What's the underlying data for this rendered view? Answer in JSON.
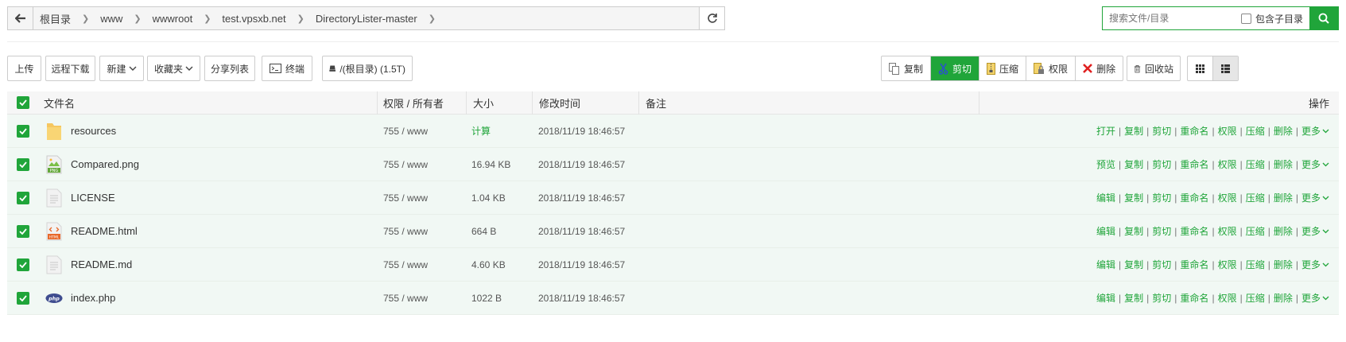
{
  "address": {
    "crumbs": [
      "根目录",
      "www",
      "wwwroot",
      "test.vpsxb.net",
      "DirectoryLister-master"
    ]
  },
  "search": {
    "placeholder": "搜索文件/目录",
    "subdir_label": "包含子目录"
  },
  "toolbar": {
    "upload": "上传",
    "remote_download": "远程下载",
    "new": "新建",
    "favorites": "收藏夹",
    "share_list": "分享列表",
    "terminal": "终端",
    "disk": "/(根目录) (1.5T)",
    "copy": "复制",
    "cut": "剪切",
    "compress": "压缩",
    "permission": "权限",
    "delete": "删除",
    "recycle_bin": "回收站"
  },
  "table": {
    "headers": {
      "name": "文件名",
      "perm": "权限 / 所有者",
      "size": "大小",
      "mtime": "修改时间",
      "note": "备注",
      "ops": "操作"
    },
    "rows": [
      {
        "name": "resources",
        "icon": "folder-icon",
        "perm": "755 / www",
        "size": "计算",
        "mtime": "2018/11/19 18:46:57",
        "ops": [
          "打开",
          "复制",
          "剪切",
          "重命名",
          "权限",
          "压缩",
          "删除",
          "更多"
        ]
      },
      {
        "name": "Compared.png",
        "icon": "png-file-icon",
        "perm": "755 / www",
        "size": "16.94 KB",
        "mtime": "2018/11/19 18:46:57",
        "ops": [
          "预览",
          "复制",
          "剪切",
          "重命名",
          "权限",
          "压缩",
          "删除",
          "更多"
        ]
      },
      {
        "name": "LICENSE",
        "icon": "text-file-icon",
        "perm": "755 / www",
        "size": "1.04 KB",
        "mtime": "2018/11/19 18:46:57",
        "ops": [
          "编辑",
          "复制",
          "剪切",
          "重命名",
          "权限",
          "压缩",
          "删除",
          "更多"
        ]
      },
      {
        "name": "README.html",
        "icon": "html-file-icon",
        "perm": "755 / www",
        "size": "664 B",
        "mtime": "2018/11/19 18:46:57",
        "ops": [
          "编辑",
          "复制",
          "剪切",
          "重命名",
          "权限",
          "压缩",
          "删除",
          "更多"
        ]
      },
      {
        "name": "README.md",
        "icon": "text-file-icon",
        "perm": "755 / www",
        "size": "4.60 KB",
        "mtime": "2018/11/19 18:46:57",
        "ops": [
          "编辑",
          "复制",
          "剪切",
          "重命名",
          "权限",
          "压缩",
          "删除",
          "更多"
        ]
      },
      {
        "name": "index.php",
        "icon": "php-file-icon",
        "perm": "755 / www",
        "size": "1022 B",
        "mtime": "2018/11/19 18:46:57",
        "ops": [
          "编辑",
          "复制",
          "剪切",
          "重命名",
          "权限",
          "压缩",
          "删除",
          "更多"
        ]
      }
    ]
  },
  "colors": {
    "accent": "#20a53a",
    "row_bg": "#f1f8f4",
    "header_bg": "#f6f6f6"
  }
}
